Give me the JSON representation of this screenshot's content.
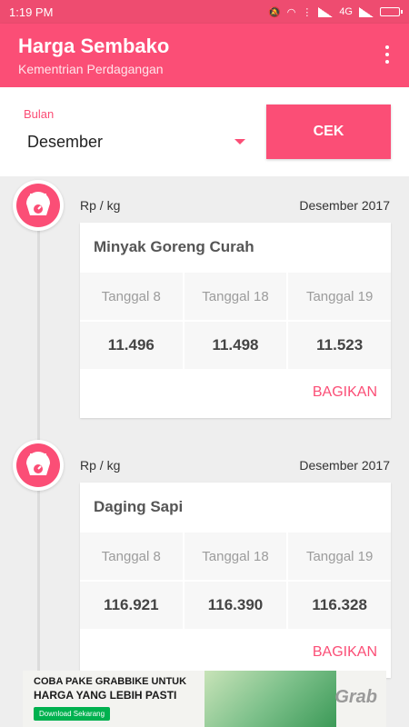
{
  "status_bar": {
    "time": "1:19 PM",
    "network": "4G"
  },
  "app_bar": {
    "title": "Harga Sembako",
    "subtitle": "Kementrian Perdagangan"
  },
  "filter": {
    "label": "Bulan",
    "selected": "Desember",
    "button": "CEK"
  },
  "entries": [
    {
      "unit": "Rp / kg",
      "period": "Desember 2017",
      "name": "Minyak Goreng Curah",
      "dates": [
        "Tanggal 8",
        "Tanggal 18",
        "Tanggal 19"
      ],
      "prices": [
        "11.496",
        "11.498",
        "11.523"
      ],
      "share": "BAGIKAN"
    },
    {
      "unit": "Rp / kg",
      "period": "Desember 2017",
      "name": "Daging Sapi",
      "dates": [
        "Tanggal 8",
        "Tanggal 18",
        "Tanggal 19"
      ],
      "prices": [
        "116.921",
        "116.390",
        "116.328"
      ],
      "share": "BAGIKAN"
    }
  ],
  "ad": {
    "line1": "COBA PAKE GRABBIKE UNTUK",
    "line2": "HARGA YANG LEBIH PASTI",
    "button": "Download Sekarang",
    "brand": "Grab"
  },
  "colors": {
    "primary": "#fb4e76",
    "status_bar": "#ee4c70",
    "background": "#eeeeee"
  },
  "icons": {
    "entry_badge": "scale-icon",
    "menu": "overflow-menu-icon"
  }
}
